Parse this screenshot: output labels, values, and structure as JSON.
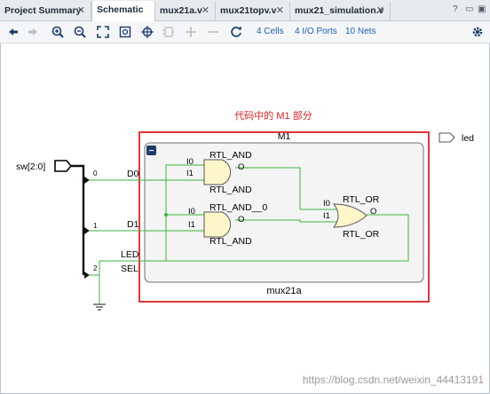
{
  "tabs": [
    {
      "label": "Project Summary",
      "active": false
    },
    {
      "label": "Schematic",
      "active": true
    },
    {
      "label": "mux21a.v",
      "active": false
    },
    {
      "label": "mux21topv.v",
      "active": false
    },
    {
      "label": "mux21_simulation.v",
      "active": false
    }
  ],
  "tab_right": {
    "help": "?",
    "restore": "▭",
    "maximize": "▣"
  },
  "toolbar": {
    "cells_label": "4 Cells",
    "ports_label": "4 I/O Ports",
    "nets_label": "10 Nets"
  },
  "schematic": {
    "annotation": "代码中的 M1 部分",
    "module_instance": "M1",
    "module_name": "mux21a",
    "input_port": "sw[2:0]",
    "output_port": "led",
    "bus_bits": [
      "0",
      "1",
      "2"
    ],
    "net_labels": {
      "d0": "D0",
      "d1": "D1",
      "led_net": "LED",
      "sel": "SEL"
    },
    "gate1": {
      "name": "RTL_AND",
      "type_label": "RTL_AND",
      "in0": "I0",
      "in1": "I1",
      "out": "O"
    },
    "gate2": {
      "name": "RTL_AND__0",
      "type_label": "RTL_AND",
      "in0": "I0",
      "in1": "I1",
      "out": "O"
    },
    "gate3": {
      "name": "RTL_OR",
      "type_label": "RTL_OR",
      "in0": "I0",
      "in1": "I1",
      "out": "O"
    },
    "collapse_symbol": "−"
  },
  "watermark": "https://blog.csdn.net/weixin_44413191",
  "colors": {
    "wire": "#3db33d",
    "highlight": "#e02020",
    "gate_fill": "#fff7c9",
    "accent": "#1c5fb8"
  }
}
